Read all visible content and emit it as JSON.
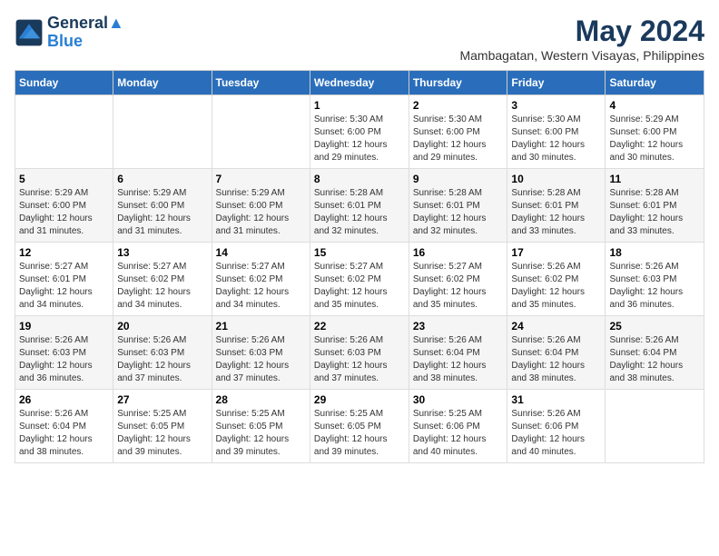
{
  "logo": {
    "line1": "General",
    "line2": "Blue"
  },
  "title": "May 2024",
  "subtitle": "Mambagatan, Western Visayas, Philippines",
  "weekdays": [
    "Sunday",
    "Monday",
    "Tuesday",
    "Wednesday",
    "Thursday",
    "Friday",
    "Saturday"
  ],
  "weeks": [
    [
      {
        "num": "",
        "sunrise": "",
        "sunset": "",
        "daylight": ""
      },
      {
        "num": "",
        "sunrise": "",
        "sunset": "",
        "daylight": ""
      },
      {
        "num": "",
        "sunrise": "",
        "sunset": "",
        "daylight": ""
      },
      {
        "num": "1",
        "sunrise": "Sunrise: 5:30 AM",
        "sunset": "Sunset: 6:00 PM",
        "daylight": "Daylight: 12 hours and 29 minutes."
      },
      {
        "num": "2",
        "sunrise": "Sunrise: 5:30 AM",
        "sunset": "Sunset: 6:00 PM",
        "daylight": "Daylight: 12 hours and 29 minutes."
      },
      {
        "num": "3",
        "sunrise": "Sunrise: 5:30 AM",
        "sunset": "Sunset: 6:00 PM",
        "daylight": "Daylight: 12 hours and 30 minutes."
      },
      {
        "num": "4",
        "sunrise": "Sunrise: 5:29 AM",
        "sunset": "Sunset: 6:00 PM",
        "daylight": "Daylight: 12 hours and 30 minutes."
      }
    ],
    [
      {
        "num": "5",
        "sunrise": "Sunrise: 5:29 AM",
        "sunset": "Sunset: 6:00 PM",
        "daylight": "Daylight: 12 hours and 31 minutes."
      },
      {
        "num": "6",
        "sunrise": "Sunrise: 5:29 AM",
        "sunset": "Sunset: 6:00 PM",
        "daylight": "Daylight: 12 hours and 31 minutes."
      },
      {
        "num": "7",
        "sunrise": "Sunrise: 5:29 AM",
        "sunset": "Sunset: 6:00 PM",
        "daylight": "Daylight: 12 hours and 31 minutes."
      },
      {
        "num": "8",
        "sunrise": "Sunrise: 5:28 AM",
        "sunset": "Sunset: 6:01 PM",
        "daylight": "Daylight: 12 hours and 32 minutes."
      },
      {
        "num": "9",
        "sunrise": "Sunrise: 5:28 AM",
        "sunset": "Sunset: 6:01 PM",
        "daylight": "Daylight: 12 hours and 32 minutes."
      },
      {
        "num": "10",
        "sunrise": "Sunrise: 5:28 AM",
        "sunset": "Sunset: 6:01 PM",
        "daylight": "Daylight: 12 hours and 33 minutes."
      },
      {
        "num": "11",
        "sunrise": "Sunrise: 5:28 AM",
        "sunset": "Sunset: 6:01 PM",
        "daylight": "Daylight: 12 hours and 33 minutes."
      }
    ],
    [
      {
        "num": "12",
        "sunrise": "Sunrise: 5:27 AM",
        "sunset": "Sunset: 6:01 PM",
        "daylight": "Daylight: 12 hours and 34 minutes."
      },
      {
        "num": "13",
        "sunrise": "Sunrise: 5:27 AM",
        "sunset": "Sunset: 6:02 PM",
        "daylight": "Daylight: 12 hours and 34 minutes."
      },
      {
        "num": "14",
        "sunrise": "Sunrise: 5:27 AM",
        "sunset": "Sunset: 6:02 PM",
        "daylight": "Daylight: 12 hours and 34 minutes."
      },
      {
        "num": "15",
        "sunrise": "Sunrise: 5:27 AM",
        "sunset": "Sunset: 6:02 PM",
        "daylight": "Daylight: 12 hours and 35 minutes."
      },
      {
        "num": "16",
        "sunrise": "Sunrise: 5:27 AM",
        "sunset": "Sunset: 6:02 PM",
        "daylight": "Daylight: 12 hours and 35 minutes."
      },
      {
        "num": "17",
        "sunrise": "Sunrise: 5:26 AM",
        "sunset": "Sunset: 6:02 PM",
        "daylight": "Daylight: 12 hours and 35 minutes."
      },
      {
        "num": "18",
        "sunrise": "Sunrise: 5:26 AM",
        "sunset": "Sunset: 6:03 PM",
        "daylight": "Daylight: 12 hours and 36 minutes."
      }
    ],
    [
      {
        "num": "19",
        "sunrise": "Sunrise: 5:26 AM",
        "sunset": "Sunset: 6:03 PM",
        "daylight": "Daylight: 12 hours and 36 minutes."
      },
      {
        "num": "20",
        "sunrise": "Sunrise: 5:26 AM",
        "sunset": "Sunset: 6:03 PM",
        "daylight": "Daylight: 12 hours and 37 minutes."
      },
      {
        "num": "21",
        "sunrise": "Sunrise: 5:26 AM",
        "sunset": "Sunset: 6:03 PM",
        "daylight": "Daylight: 12 hours and 37 minutes."
      },
      {
        "num": "22",
        "sunrise": "Sunrise: 5:26 AM",
        "sunset": "Sunset: 6:03 PM",
        "daylight": "Daylight: 12 hours and 37 minutes."
      },
      {
        "num": "23",
        "sunrise": "Sunrise: 5:26 AM",
        "sunset": "Sunset: 6:04 PM",
        "daylight": "Daylight: 12 hours and 38 minutes."
      },
      {
        "num": "24",
        "sunrise": "Sunrise: 5:26 AM",
        "sunset": "Sunset: 6:04 PM",
        "daylight": "Daylight: 12 hours and 38 minutes."
      },
      {
        "num": "25",
        "sunrise": "Sunrise: 5:26 AM",
        "sunset": "Sunset: 6:04 PM",
        "daylight": "Daylight: 12 hours and 38 minutes."
      }
    ],
    [
      {
        "num": "26",
        "sunrise": "Sunrise: 5:26 AM",
        "sunset": "Sunset: 6:04 PM",
        "daylight": "Daylight: 12 hours and 38 minutes."
      },
      {
        "num": "27",
        "sunrise": "Sunrise: 5:25 AM",
        "sunset": "Sunset: 6:05 PM",
        "daylight": "Daylight: 12 hours and 39 minutes."
      },
      {
        "num": "28",
        "sunrise": "Sunrise: 5:25 AM",
        "sunset": "Sunset: 6:05 PM",
        "daylight": "Daylight: 12 hours and 39 minutes."
      },
      {
        "num": "29",
        "sunrise": "Sunrise: 5:25 AM",
        "sunset": "Sunset: 6:05 PM",
        "daylight": "Daylight: 12 hours and 39 minutes."
      },
      {
        "num": "30",
        "sunrise": "Sunrise: 5:25 AM",
        "sunset": "Sunset: 6:06 PM",
        "daylight": "Daylight: 12 hours and 40 minutes."
      },
      {
        "num": "31",
        "sunrise": "Sunrise: 5:26 AM",
        "sunset": "Sunset: 6:06 PM",
        "daylight": "Daylight: 12 hours and 40 minutes."
      },
      {
        "num": "",
        "sunrise": "",
        "sunset": "",
        "daylight": ""
      }
    ]
  ]
}
